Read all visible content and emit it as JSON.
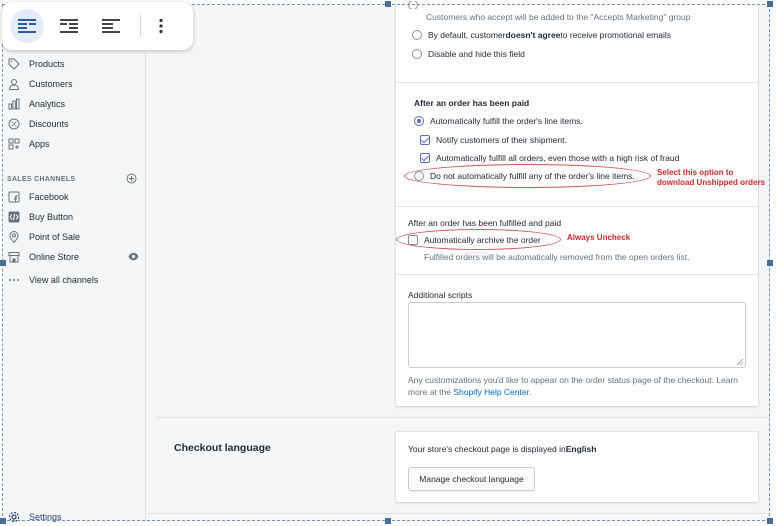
{
  "sidebar": {
    "items": [
      {
        "label": "Products",
        "icon": "tag-icon"
      },
      {
        "label": "Customers",
        "icon": "person-icon"
      },
      {
        "label": "Analytics",
        "icon": "bar-chart-icon"
      },
      {
        "label": "Discounts",
        "icon": "discount-icon"
      },
      {
        "label": "Apps",
        "icon": "apps-icon"
      }
    ],
    "sales_channels_label": "SALES CHANNELS",
    "channels": [
      {
        "label": "Facebook",
        "icon": "facebook-icon"
      },
      {
        "label": "Buy Button",
        "icon": "code-icon"
      },
      {
        "label": "Point of Sale",
        "icon": "location-icon"
      },
      {
        "label": "Online Store",
        "icon": "store-icon"
      }
    ],
    "view_all": "View all channels",
    "settings": "Settings"
  },
  "marketing": {
    "note": "Customers who accept will be added to the \"Accepts Marketing\" group",
    "default_prefix": "By default, customer ",
    "default_bold": "doesn't agree",
    "default_suffix": " to receive promotional emails",
    "disable": "Disable and hide this field"
  },
  "after_paid": {
    "heading": "After an order has been paid",
    "opt_fulfill": "Automatically fulfill the order's line items.",
    "notify": "Notify customers of their shipment.",
    "high_risk": "Automatically fulfill all orders, even those with a high risk of fraud",
    "no_fulfill": "Do not automatically fulfill any of the order's line items.",
    "annotation": "Select this option to download Unshipped orders"
  },
  "after_fulfilled": {
    "heading": "After an order has been fulfilled and paid",
    "archive": "Automatically archive the order",
    "annotation": "Always Uncheck",
    "note": "Fulfilled orders will be automatically removed from the open orders list."
  },
  "scripts": {
    "label": "Additional scripts",
    "help_prefix": "Any customizations you'd like to appear on the order status page of the checkout. Learn more at the ",
    "help_link": "Shopify Help Center",
    "help_suffix": "."
  },
  "checkout_language": {
    "title": "Checkout language",
    "desc_prefix": "Your store's checkout page is displayed in ",
    "language": "English",
    "button": "Manage checkout language"
  },
  "colors": {
    "accent": "#5c6ac4",
    "annotation": "#d0272c",
    "link": "#006fbb"
  }
}
